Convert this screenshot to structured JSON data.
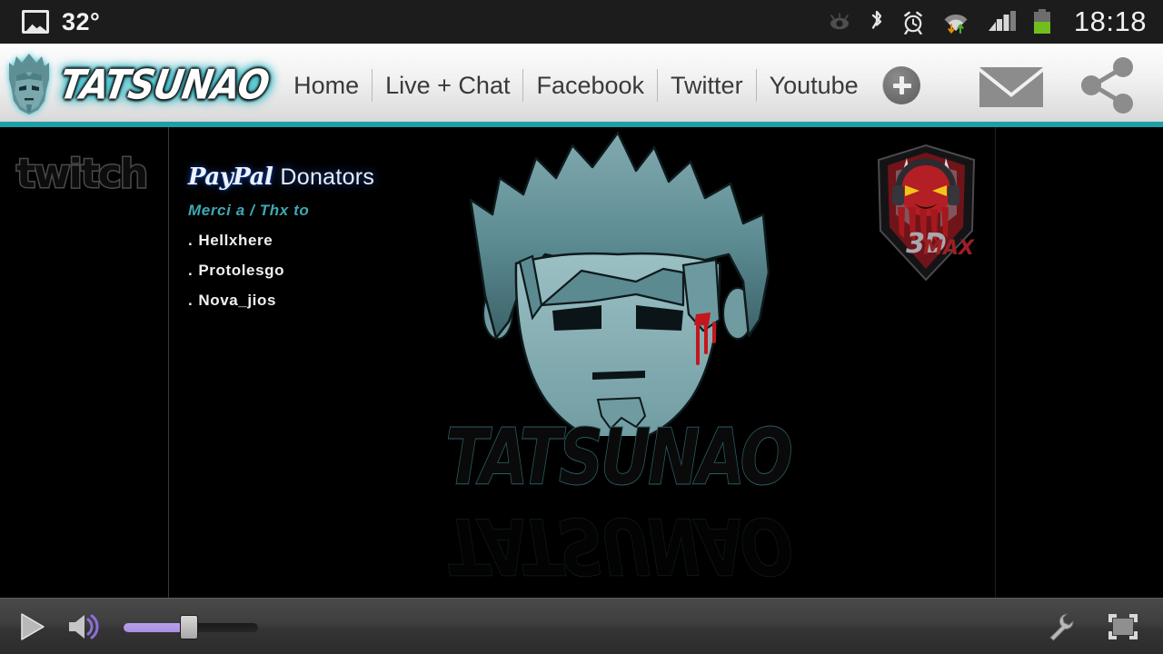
{
  "statusbar": {
    "temperature": "32°",
    "time": "18:18",
    "icons": {
      "photo": "photo-icon",
      "smart_stay": "smart-stay-eye-icon",
      "bluetooth": "bluetooth-icon",
      "alarm": "alarm-clock-icon",
      "wifi": "wifi-data-transfer-icon",
      "signal": "cellular-signal-icon",
      "battery": "battery-icon"
    }
  },
  "header": {
    "brand": {
      "avatar": "tatsunao-avatar-icon",
      "wordmark": "TATSUNAO"
    },
    "nav": [
      {
        "label": "Home"
      },
      {
        "label": "Live + Chat"
      },
      {
        "label": "Facebook"
      },
      {
        "label": "Twitter"
      },
      {
        "label": "Youtube"
      }
    ],
    "add_button": "+",
    "actions": [
      {
        "name": "mail-icon"
      },
      {
        "name": "share-icon"
      }
    ]
  },
  "content": {
    "twitch_logo": "twitch",
    "donators": {
      "paypal_wordmark": "PayPal",
      "title": "Donators",
      "subtitle": "Merci a / Thx to",
      "list": [
        {
          "bullet": ".",
          "name": "Hellxhere"
        },
        {
          "bullet": ".",
          "name": "Protolesgo"
        },
        {
          "bullet": ".",
          "name": "Nova_jios"
        }
      ]
    },
    "sponsor_logo": {
      "name": "3d-max-devil-shield-logo",
      "text": "3D"
    },
    "artwork": {
      "avatar": "tatsunao-character-artwork",
      "wordmark": "TATSUNAO"
    }
  },
  "player": {
    "play_button": "play-icon",
    "volume_icon": "speaker-volume-icon",
    "volume_percent": 45,
    "settings_button": "wrench-settings-icon",
    "fullscreen_button": "fullscreen-icon"
  },
  "colors": {
    "accent_teal": "#1d9fa8",
    "volume_purple": "#b9a0ec",
    "status_bg": "#1c1c1c",
    "devil_red": "#b31f24"
  }
}
